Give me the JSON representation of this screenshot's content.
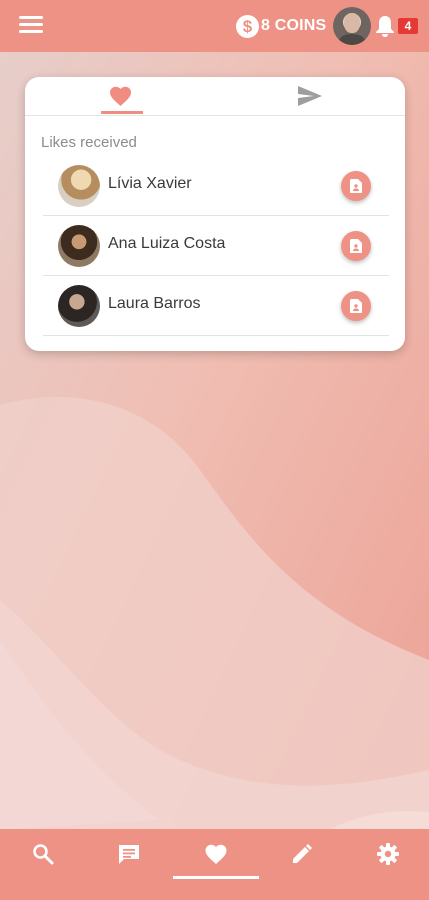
{
  "header": {
    "menu_icon": "hamburger-menu-icon",
    "coin_icon": "dollar-coin-icon",
    "coin_symbol": "$",
    "coins_label": "8 COINS",
    "avatar": "user-avatar",
    "bell_icon": "notification-bell-icon",
    "notification_count": "4"
  },
  "tabs": [
    {
      "icon": "heart-icon",
      "active": true
    },
    {
      "icon": "send-icon",
      "active": false
    }
  ],
  "likes": {
    "section_label": "Likes received",
    "items": [
      {
        "name": "Lívia Xavier",
        "action_icon": "profile-card-icon"
      },
      {
        "name": "Ana Luiza Costa",
        "action_icon": "profile-card-icon"
      },
      {
        "name": "Laura Barros",
        "action_icon": "profile-card-icon"
      }
    ]
  },
  "bottom_nav": [
    {
      "icon": "search-icon",
      "active": false
    },
    {
      "icon": "chat-icon",
      "active": false
    },
    {
      "icon": "heart-icon",
      "active": true
    },
    {
      "icon": "edit-pencil-icon",
      "active": false
    },
    {
      "icon": "gear-icon",
      "active": false
    }
  ],
  "colors": {
    "accent": "#ee9286",
    "badge": "#e53935",
    "inactive_tab_icon": "#9e9e9e"
  }
}
